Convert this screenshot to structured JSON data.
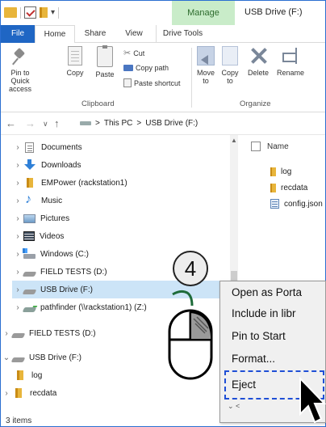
{
  "titlebar": {
    "manage_tab": "Manage",
    "title": "USB Drive (F:)"
  },
  "tabs": [
    {
      "label": "File"
    },
    {
      "label": "Home"
    },
    {
      "label": "Share"
    },
    {
      "label": "View"
    },
    {
      "label": "Drive Tools"
    }
  ],
  "ribbon": {
    "pin": "Pin to Quick access",
    "copy": "Copy",
    "paste": "Paste",
    "cut": "Cut",
    "copy_path": "Copy path",
    "paste_shortcut": "Paste shortcut",
    "clipboard_label": "Clipboard",
    "move_to": "Move to",
    "copy_to": "Copy to",
    "delete": "Delete",
    "rename": "Rename",
    "organize_label": "Organize"
  },
  "address": {
    "back": "←",
    "forward": "→",
    "dropdown": "∨",
    "up": "↑",
    "this_pc": "This PC",
    "separator": ">",
    "location": "USB Drive (F:)"
  },
  "nav": [
    {
      "label": "Documents",
      "icon": "documents-icon"
    },
    {
      "label": "Downloads",
      "icon": "downloads-icon"
    },
    {
      "label": "EMPower (rackstation1)",
      "icon": "folder-icon"
    },
    {
      "label": "Music",
      "icon": "music-icon"
    },
    {
      "label": "Pictures",
      "icon": "pictures-icon"
    },
    {
      "label": "Videos",
      "icon": "videos-icon"
    },
    {
      "label": "Windows (C:)",
      "icon": "windows-drive-icon"
    },
    {
      "label": "FIELD TESTS (D:)",
      "icon": "drive-icon"
    },
    {
      "label": "USB Drive (F:)",
      "icon": "usb-drive-icon"
    },
    {
      "label": "pathfinder (\\\\rackstation1) (Z:)",
      "icon": "network-drive-icon"
    },
    {
      "label": "FIELD TESTS (D:)",
      "icon": "drive-icon"
    },
    {
      "label": "USB Drive (F:)",
      "icon": "usb-drive-icon"
    },
    {
      "label": "log",
      "icon": "folder-icon"
    },
    {
      "label": "recdata",
      "icon": "folder-icon"
    }
  ],
  "content": {
    "column_name": "Name",
    "files": [
      {
        "name": "log",
        "icon": "folder-icon"
      },
      {
        "name": "recdata",
        "icon": "folder-icon"
      },
      {
        "name": "config.json",
        "icon": "json-file-icon"
      }
    ]
  },
  "context_menu": {
    "items": [
      {
        "label": "Open as Porta"
      },
      {
        "label": "Include in libr"
      },
      {
        "label": "Pin to Start"
      },
      {
        "label": "Format..."
      },
      {
        "label": "Eject"
      }
    ]
  },
  "step": "4",
  "status": {
    "items": "3 items"
  }
}
